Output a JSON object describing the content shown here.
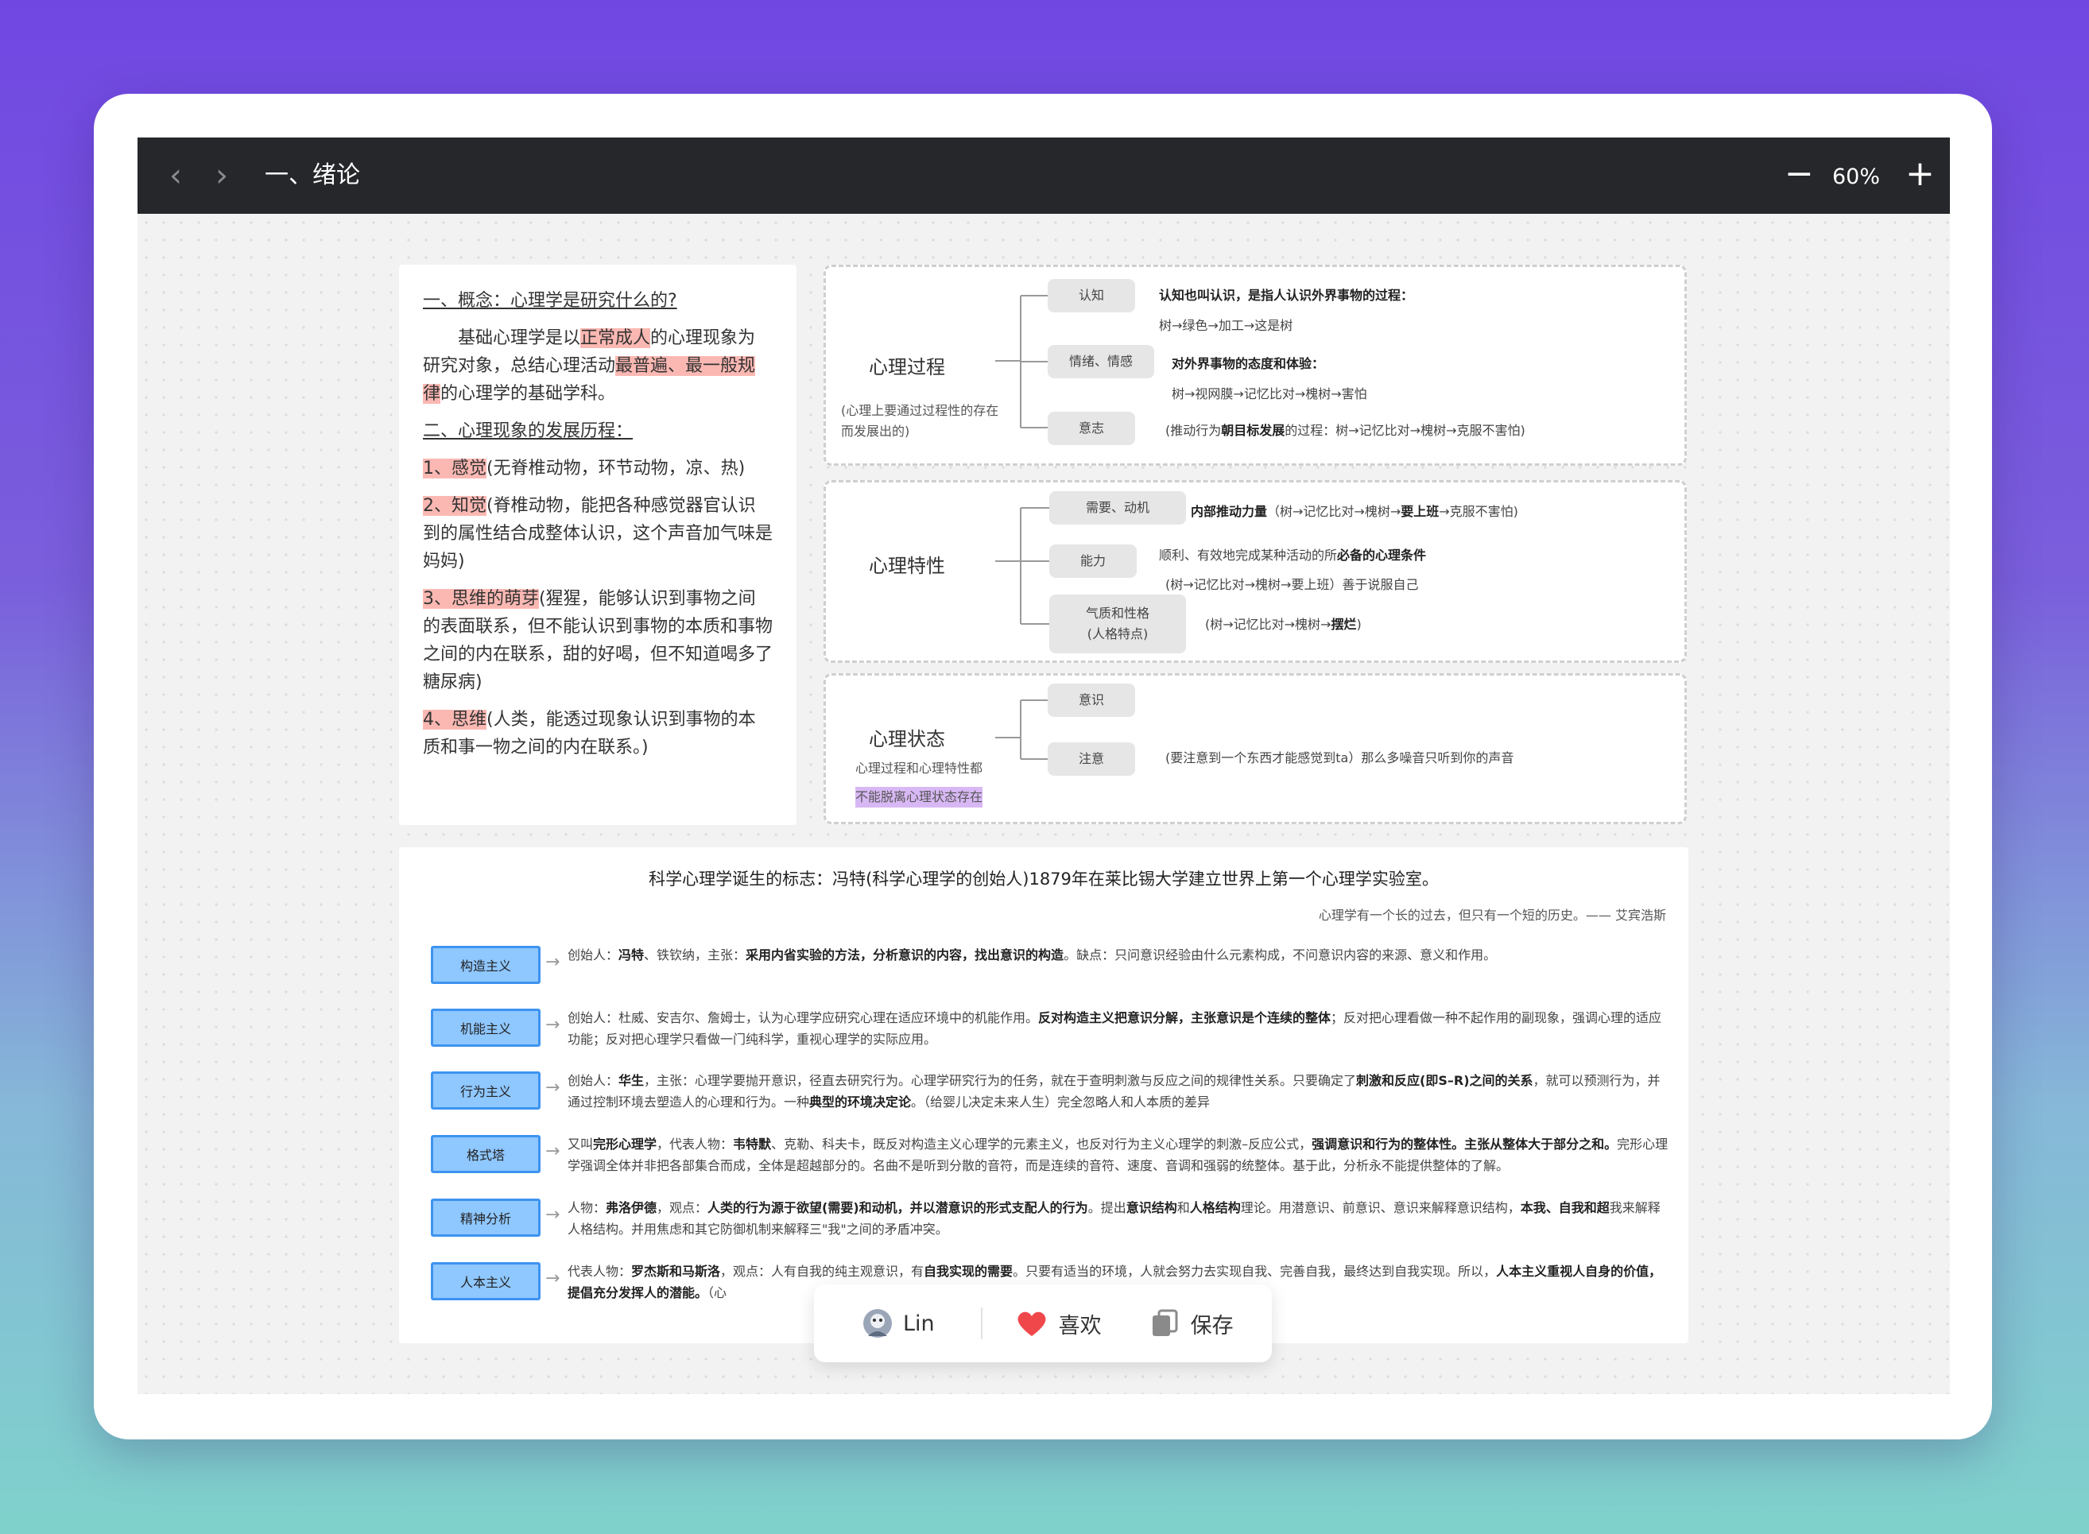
{
  "toolbar": {
    "back_icon": "chevron-left-icon",
    "forward_icon": "chevron-right-icon",
    "title": "一、绪论",
    "zoom_out": "−",
    "zoom": "60%",
    "zoom_in": "+"
  },
  "note": {
    "heading1": "一、概念：心理学是研究什么的?",
    "p1": {
      "a": "基础心理学是以",
      "b": "正常成人",
      "c": "的心理现象为研究对象，总结心理活动",
      "d": "最普遍、最一般规律",
      "e": "的心理学的基础学科。"
    },
    "heading2": "二、心理现象的发展历程：",
    "items": [
      {
        "label": "1、感觉",
        "text": "(无脊椎动物，环节动物，凉、热)"
      },
      {
        "label": "2、知觉",
        "text": "(脊椎动物，能把各种感觉器官认识到的属性结合成整体认识，这个声音加气味是妈妈)"
      },
      {
        "label": "3、思维的萌芽",
        "text": "(猩猩，能够认识到事物之间的表面联系，但不能认识到事物的本质和事物之间的内在联系，甜的好喝，但不知道喝多了糖尿病)"
      },
      {
        "label": "4、思维",
        "text": "(人类，能透过现象认识到事物的本质和事一物之间的内在联系。)"
      }
    ]
  },
  "mindmap": {
    "process": {
      "title": "心理过程",
      "sub": "(心理上要通过过程性的存在而发展出的)",
      "nodes": [
        "认知",
        "情绪、情感",
        "意志"
      ],
      "desc": [
        {
          "l1": "认知也叫认识，是指人认识外界事物的过程：",
          "l2": "树→绿色→加工→这是树"
        },
        {
          "l1": "对外界事物的态度和体验：",
          "l2": "树→视网膜→记忆比对→槐树→害怕"
        },
        {
          "a": "(推动行为",
          "b": "朝目标发展",
          "c": "的过程：树→记忆比对→槐树→克服不害怕)"
        }
      ]
    },
    "traits": {
      "title": "心理特性",
      "nodes": [
        "需要、动机",
        "能力",
        "气质和性格",
        "(人格特点)"
      ],
      "desc": [
        {
          "a": "内部推动力量",
          "b": "（树→记忆比对→槐树→",
          "c": "要上班",
          "d": "→克服不害怕)"
        },
        {
          "a": "顺利、有效地完成某种活动的所",
          "b": "必备的心理条件",
          "l2": "(树→记忆比对→槐树→要上班）善于说服自己"
        },
        {
          "a": "(树→记忆比对→槐树→",
          "b": "摆烂",
          "c": ")"
        }
      ]
    },
    "state": {
      "title": "心理状态",
      "sub1": "心理过程和心理特性都",
      "sub2": "不能脱离心理状态存在",
      "nodes": [
        "意识",
        "注意"
      ],
      "desc": "(要注意到一个东西才能感觉到ta）那么多噪音只听到你的声音"
    }
  },
  "schools": {
    "title": "科学心理学诞生的标志：冯特(科学心理学的创始人)1879年在莱比锡大学建立世界上第一个心理学实验室。",
    "quote": "心理学有一个长的过去，但只有一个短的历史。—— 艾宾浩斯",
    "items": [
      {
        "name": "构造主义",
        "segs": [
          {
            "t": "创始人："
          },
          {
            "t": "冯特",
            "b": true
          },
          {
            "t": "、铁钦纳，主张："
          },
          {
            "t": "采用内省实验的方法，分析意识的内容，找出意识的构造",
            "b": true
          },
          {
            "t": "。缺点：只问意识经验由什么元素构成，不问意识内容的来源、意义和作用。"
          }
        ]
      },
      {
        "name": "机能主义",
        "segs": [
          {
            "t": "创始人：杜威、安吉尔、詹姆士，认为心理学应研究心理在适应环境中的机能作用。"
          },
          {
            "t": "反对构造主义把意识分解，主张意识是个连续的整体",
            "b": true
          },
          {
            "t": "；反对把心理看做一种不起作用的副现象，强调心理的适应功能；反对把心理学只看做一门纯科学，重视心理学的实际应用。"
          }
        ]
      },
      {
        "name": "行为主义",
        "segs": [
          {
            "t": "创始人："
          },
          {
            "t": "华生",
            "b": true
          },
          {
            "t": "，主张：心理学要抛开意识，径直去研究行为。心理学研究行为的任务，就在于查明刺激与反应之间的规律性关系。只要确定了"
          },
          {
            "t": "刺激和反应(即S–R)之间的关系",
            "b": true
          },
          {
            "t": "，就可以预测行为，并通过控制环境去塑造人的心理和行为。一种"
          },
          {
            "t": "典型的环境决定论",
            "b": true
          },
          {
            "t": "。（给婴儿决定未来人生）完全忽略人和人本质的差异"
          }
        ]
      },
      {
        "name": "格式塔",
        "segs": [
          {
            "t": "又叫"
          },
          {
            "t": "完形心理学",
            "b": true
          },
          {
            "t": "，代表人物："
          },
          {
            "t": "韦特默",
            "b": true
          },
          {
            "t": "、克勒、科夫卡，既反对构造主义心理学的元素主义，也反对行为主义心理学的刺激–反应公式，"
          },
          {
            "t": "强调意识和行为的整体性。主张从整体大于部分之和。",
            "b": true
          },
          {
            "t": "完形心理学强调全体并非把各部集合而成，全体是超越部分的。名曲不是听到分散的音符，而是连续的音符、速度、音调和强弱的统整体。基于此，分析永不能提供整体的了解。"
          }
        ]
      },
      {
        "name": "精神分析",
        "segs": [
          {
            "t": "人物："
          },
          {
            "t": "弗洛伊德",
            "b": true
          },
          {
            "t": "，观点："
          },
          {
            "t": "人类的行为源于欲望(需要)和动机，并以潜意识的形式支配人的行为",
            "b": true
          },
          {
            "t": "。提出"
          },
          {
            "t": "意识结构",
            "b": true
          },
          {
            "t": "和"
          },
          {
            "t": "人格结构",
            "b": true
          },
          {
            "t": "理论。用潜意识、前意识、意识来解释意识结构，"
          },
          {
            "t": "本我、自我和超",
            "b": true
          },
          {
            "t": "我来解释人格结构。并用焦虑和其它防御机制来解释三\"我\"之间的矛盾冲突。"
          }
        ]
      },
      {
        "name": "人本主义",
        "segs": [
          {
            "t": "代表人物："
          },
          {
            "t": "罗杰斯和马斯洛",
            "b": true
          },
          {
            "t": "，观点：人有自我的纯主观意识，有"
          },
          {
            "t": "自我实现的需要",
            "b": true
          },
          {
            "t": "。只要有适当的环境，人就会努力去实现自我、完善自我，最终达到自我实现。所以，"
          },
          {
            "t": "人本主义重视人自身的价值，提倡充分发挥人的潜能。",
            "b": true
          },
          {
            "t": "（心"
          }
        ]
      }
    ]
  },
  "actions": {
    "user": "Lin",
    "like": "喜欢",
    "save": "保存",
    "avatar_icon": "avatar-icon",
    "like_icon": "heart-icon",
    "save_icon": "copy-icon",
    "heart_color": "#f0474b"
  }
}
